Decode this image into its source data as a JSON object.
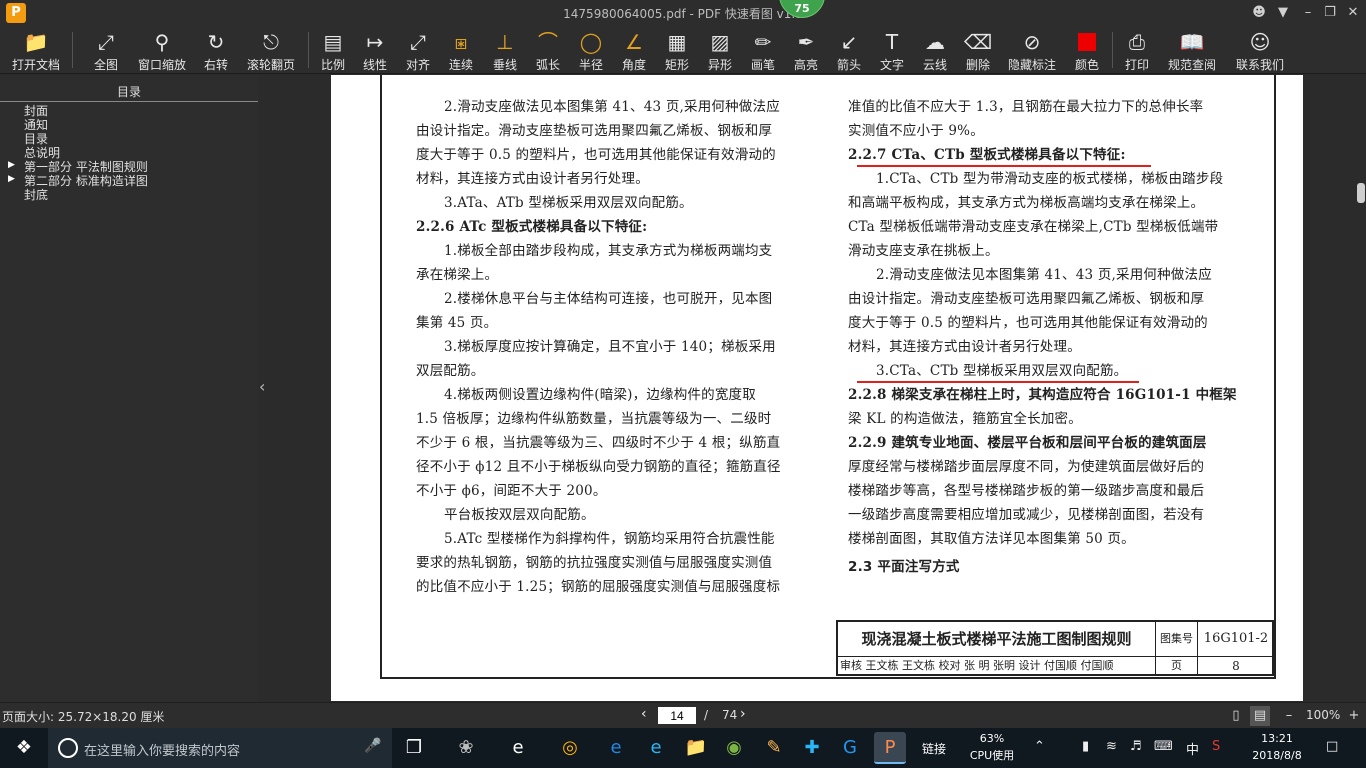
{
  "window": {
    "title": "1475980064005.pdf - PDF 快速看图 v1.9",
    "badge": "75",
    "logo": "P"
  },
  "toolbar": {
    "items": [
      {
        "name": "open-doc",
        "label": "打开文档",
        "icon": "folder-icon"
      },
      {
        "name": "fit-all",
        "label": "全图",
        "icon": "fit-icon"
      },
      {
        "name": "window-zoom",
        "label": "窗口缩放",
        "icon": "magnifier-icon"
      },
      {
        "name": "rotate-right",
        "label": "右转",
        "icon": "rotate-icon"
      },
      {
        "name": "wheel-page",
        "label": "滚轮翻页",
        "icon": "mouse-icon"
      },
      {
        "name": "scale",
        "label": "比例",
        "icon": "ruler-icon"
      },
      {
        "name": "linear",
        "label": "线性",
        "icon": "linear-icon"
      },
      {
        "name": "align",
        "label": "对齐",
        "icon": "align-icon"
      },
      {
        "name": "continuous",
        "label": "连续",
        "icon": "continuous-icon"
      },
      {
        "name": "perpendicular",
        "label": "垂线",
        "icon": "perpendicular-icon"
      },
      {
        "name": "arc-length",
        "label": "弧长",
        "icon": "arc-icon"
      },
      {
        "name": "radius",
        "label": "半径",
        "icon": "radius-icon"
      },
      {
        "name": "angle",
        "label": "角度",
        "icon": "angle-icon"
      },
      {
        "name": "rectangle",
        "label": "矩形",
        "icon": "rectangle-icon"
      },
      {
        "name": "irregular",
        "label": "异形",
        "icon": "irregular-icon"
      },
      {
        "name": "brush",
        "label": "画笔",
        "icon": "pencil-icon"
      },
      {
        "name": "highlight",
        "label": "高亮",
        "icon": "highlighter-icon"
      },
      {
        "name": "arrow",
        "label": "箭头",
        "icon": "arrow-icon"
      },
      {
        "name": "text",
        "label": "文字",
        "icon": "text-icon"
      },
      {
        "name": "cloud-line",
        "label": "云线",
        "icon": "cloud-icon"
      },
      {
        "name": "delete",
        "label": "删除",
        "icon": "eraser-icon"
      },
      {
        "name": "hide-marks",
        "label": "隐藏标注",
        "icon": "eye-slash-icon"
      },
      {
        "name": "color",
        "label": "颜色",
        "icon": "color-swatch-icon"
      },
      {
        "name": "print",
        "label": "打印",
        "icon": "printer-icon"
      },
      {
        "name": "spec-query",
        "label": "规范查阅",
        "icon": "book-icon"
      },
      {
        "name": "contact",
        "label": "联系我们",
        "icon": "user-icon"
      }
    ],
    "color_swatch": "#e00000"
  },
  "sidebar": {
    "title": "目录",
    "items": [
      {
        "label": "封面",
        "expandable": false
      },
      {
        "label": "通知",
        "expandable": false
      },
      {
        "label": "目录",
        "expandable": false
      },
      {
        "label": "总说明",
        "expandable": false
      },
      {
        "label": "第一部分  平法制图规则",
        "expandable": true
      },
      {
        "label": "第二部分  标准构造详图",
        "expandable": true
      },
      {
        "label": "封底",
        "expandable": false
      }
    ]
  },
  "document": {
    "left_column": [
      {
        "text": "2.滑动支座做法见本图集第 41、43 页,采用何种做法应",
        "style": "ind"
      },
      {
        "text": "由设计指定。滑动支座垫板可选用聚四氟乙烯板、钢板和厚",
        "style": ""
      },
      {
        "text": "度大于等于 0.5 的塑料片，也可选用其他能保证有效滑动的",
        "style": ""
      },
      {
        "text": "材料，其连接方式由设计者另行处理。",
        "style": ""
      },
      {
        "text": "3.ATa、ATb 型梯板采用双层双向配筋。",
        "style": "ind"
      },
      {
        "text": "2.2.6  ATc 型板式楼梯具备以下特征:",
        "style": "head"
      },
      {
        "text": "1.梯板全部由踏步段构成，其支承方式为梯板两端均支",
        "style": "ind"
      },
      {
        "text": "承在梯梁上。",
        "style": ""
      },
      {
        "text": "2.楼梯休息平台与主体结构可连接，也可脱开，见本图",
        "style": "ind"
      },
      {
        "text": "集第 45 页。",
        "style": ""
      },
      {
        "text": "3.梯板厚度应按计算确定，且不宜小于 140；梯板采用",
        "style": "ind"
      },
      {
        "text": "双层配筋。",
        "style": ""
      },
      {
        "text": "4.梯板两侧设置边缘构件(暗梁)，边缘构件的宽度取",
        "style": "ind"
      },
      {
        "text": "1.5 倍板厚；边缘构件纵筋数量，当抗震等级为一、二级时",
        "style": ""
      },
      {
        "text": "不少于 6 根，当抗震等级为三、四级时不少于 4 根；纵筋直",
        "style": ""
      },
      {
        "text": "径不小于 ϕ12 且不小于梯板纵向受力钢筋的直径；箍筋直径",
        "style": ""
      },
      {
        "text": "不小于 ϕ6，间距不大于 200。",
        "style": ""
      },
      {
        "text": "平台板按双层双向配筋。",
        "style": "ind"
      },
      {
        "text": "5.ATc 型楼梯作为斜撑构件，钢筋均采用符合抗震性能",
        "style": "ind"
      },
      {
        "text": "要求的热轧钢筋，钢筋的抗拉强度实测值与屈服强度实测值",
        "style": ""
      },
      {
        "text": "的比值不应小于 1.25；钢筋的屈服强度实测值与屈服强度标",
        "style": ""
      }
    ],
    "right_column": [
      {
        "text": "准值的比值不应大于 1.3，且钢筋在最大拉力下的总伸长率",
        "style": ""
      },
      {
        "text": "实测值不应小于 9%。",
        "style": ""
      },
      {
        "text": "2.2.7  CTa、CTb 型板式楼梯具备以下特征:",
        "style": "head"
      },
      {
        "text": "1.CTa、CTb 型为带滑动支座的板式楼梯，梯板由踏步段",
        "style": "ind"
      },
      {
        "text": "和高端平板构成，其支承方式为梯板高端均支承在梯梁上。",
        "style": ""
      },
      {
        "text": "CTa 型梯板低端带滑动支座支承在梯梁上,CTb 型梯板低端带",
        "style": ""
      },
      {
        "text": "滑动支座支承在挑板上。",
        "style": ""
      },
      {
        "text": "2.滑动支座做法见本图集第 41、43 页,采用何种做法应",
        "style": "ind"
      },
      {
        "text": "由设计指定。滑动支座垫板可选用聚四氟乙烯板、钢板和厚",
        "style": ""
      },
      {
        "text": "度大于等于 0.5 的塑料片，也可选用其他能保证有效滑动的",
        "style": ""
      },
      {
        "text": "材料，其连接方式由设计者另行处理。",
        "style": ""
      },
      {
        "text": "3.CTa、CTb 型梯板采用双层双向配筋。",
        "style": "ind"
      },
      {
        "text": "2.2.8  梯梁支承在梯柱上时，其构造应符合 16G101-1 中框架",
        "style": "head"
      },
      {
        "text": "梁 KL 的构造做法，箍筋宜全长加密。",
        "style": ""
      },
      {
        "text": "2.2.9  建筑专业地面、楼层平台板和层间平台板的建筑面层",
        "style": "head"
      },
      {
        "text": "厚度经常与楼梯踏步面层厚度不同，为使建筑面层做好后的",
        "style": ""
      },
      {
        "text": "楼梯踏步等高，各型号楼梯踏步板的第一级踏步高度和最后",
        "style": ""
      },
      {
        "text": "一级踏步高度需要相应增加或减少，见楼梯剖面图，若没有",
        "style": ""
      },
      {
        "text": "楼梯剖面图，其取值方法详见本图集第 50 页。",
        "style": ""
      },
      {
        "text": "2.3  平面注写方式",
        "style": "sec"
      }
    ],
    "title_block": {
      "main_title": "现浇混凝土板式楼梯平法施工图制图规则",
      "atlas_label": "图集号",
      "atlas_no": "16G101-2",
      "row2": "审核 王文栋  王文栋  校对 张  明  张明  设计 付国顺  付国顺",
      "page_label": "页",
      "page_no": "8"
    }
  },
  "statusbar": {
    "page_size": "页面大小: 25.72×18.20 厘米",
    "current_page": "14",
    "slash": "/",
    "total_pages": "74",
    "zoom": "100%"
  },
  "taskbar": {
    "search_placeholder": "在这里输入你要搜索的内容",
    "tray_link": "链接",
    "cpu_percent": "63%",
    "cpu_label": "CPU使用",
    "ime": "中",
    "time": "13:21",
    "date": "2018/8/8"
  }
}
